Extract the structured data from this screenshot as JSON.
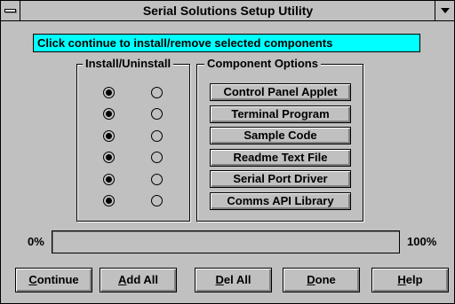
{
  "window": {
    "title": "Serial Solutions Setup Utility"
  },
  "status": {
    "message": "Click continue to install/remove selected components"
  },
  "install_group": {
    "title": "Install/Uninstall",
    "rows": [
      {
        "install": true,
        "uninstall": false
      },
      {
        "install": true,
        "uninstall": false
      },
      {
        "install": true,
        "uninstall": false
      },
      {
        "install": true,
        "uninstall": false
      },
      {
        "install": true,
        "uninstall": false
      },
      {
        "install": true,
        "uninstall": false
      }
    ]
  },
  "options_group": {
    "title": "Component Options",
    "items": [
      "Control Panel Applet",
      "Terminal Program",
      "Sample Code",
      "Readme Text File",
      "Serial Port Driver",
      "Comms API Library"
    ]
  },
  "progress": {
    "min_label": "0%",
    "max_label": "100%",
    "value_percent": 0
  },
  "buttons": {
    "continue": {
      "key": "C",
      "rest": "ontinue"
    },
    "add_all": {
      "key": "A",
      "rest": "dd All"
    },
    "del_all": {
      "key": "D",
      "rest": "el All"
    },
    "done": {
      "key": "D",
      "rest": "one"
    },
    "help": {
      "key": "H",
      "rest": "elp"
    }
  },
  "colors": {
    "face": "#c0c0c0",
    "status_bg": "#00ffff"
  }
}
